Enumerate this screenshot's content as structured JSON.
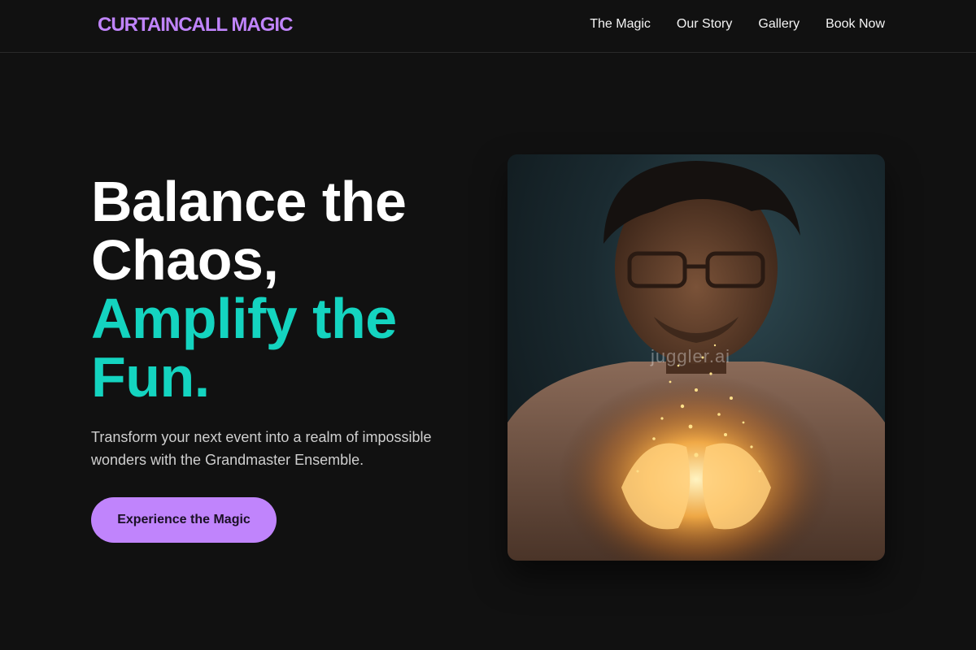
{
  "brand": {
    "logo": "CURTAINCALL MAGIC",
    "accent": "#c084fc",
    "highlight": "#14d4c0"
  },
  "nav": {
    "items": [
      {
        "label": "The Magic"
      },
      {
        "label": "Our Story"
      },
      {
        "label": "Gallery"
      },
      {
        "label": "Book Now"
      }
    ]
  },
  "hero": {
    "title_lines": [
      "Balance the",
      "Chaos,"
    ],
    "highlight_lines": [
      "Amplify the",
      "Fun."
    ],
    "subtitle": "Transform your next event into a realm of impossible wonders with the Grandmaster Ensemble.",
    "cta_label": "Experience the Magic"
  },
  "image": {
    "description_icon": "magician-photo",
    "watermark": "juggler.ai"
  }
}
